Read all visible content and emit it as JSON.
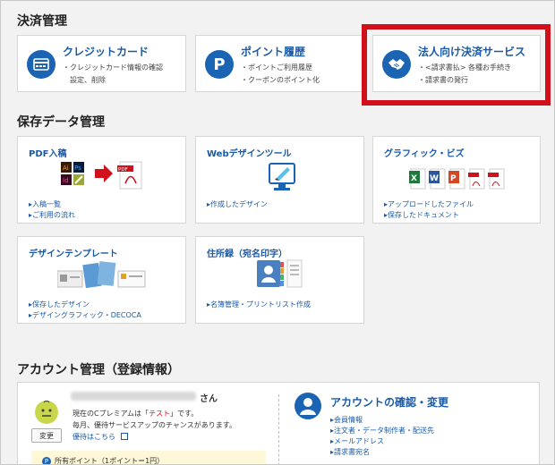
{
  "sections": {
    "payment_title": "決済管理",
    "data_title": "保存データ管理",
    "account_title": "アカウント管理（登録情報）"
  },
  "payment_cards": [
    {
      "title": "クレジットカード",
      "desc": [
        "・クレジットカード情報の確認",
        "　設定、削除"
      ],
      "icon": "credit-card-icon"
    },
    {
      "title": "ポイント履歴",
      "desc": [
        "・ポイントご利用履歴",
        "・クーポンのポイント化"
      ],
      "icon": "point-p-icon"
    },
    {
      "title": "法人向け決済サービス",
      "desc": [
        "・<請求書払> 各種お手続き",
        "・請求書の発行"
      ],
      "icon": "handshake-icon"
    }
  ],
  "data_cards": [
    {
      "title": "PDF入稿",
      "links": [
        "入稿一覧",
        "ご利用の流れ"
      ]
    },
    {
      "title": "Webデザインツール",
      "links": [
        "作成したデザイン"
      ]
    },
    {
      "title": "グラフィック・ビズ",
      "links": [
        "アップロードしたファイル",
        "保存したドキュメント"
      ]
    },
    {
      "title": "デザインテンプレート",
      "links": [
        "保存したデザイン",
        "デザイングラフィック・DECOCA"
      ]
    },
    {
      "title": "住所録（宛名印字）",
      "links": [
        "名簿管理・プリントリスト作成"
      ]
    }
  ],
  "account": {
    "name_suffix": "さん",
    "change_button": "変更",
    "plan_prefix": "現在のCプレミアムは「",
    "plan_value": "テスト",
    "plan_suffix": "」です。",
    "plan_note": "毎月、優待サービスアップのチャンスがあります。",
    "benefits_link": "優待はこちら",
    "points_label": "所有ポイント（1ポイント＝1円）",
    "confirm_title": "アカウントの確認・変更",
    "confirm_links": [
      "会員情報",
      "注文者・データ制作者・配送先",
      "メールアドレス",
      "請求書宛名"
    ]
  },
  "colors": {
    "accent": "#1a5aa6",
    "icon_blue": "#1b63b3",
    "highlight": "#d0101a",
    "plan_red": "#d0101a"
  }
}
